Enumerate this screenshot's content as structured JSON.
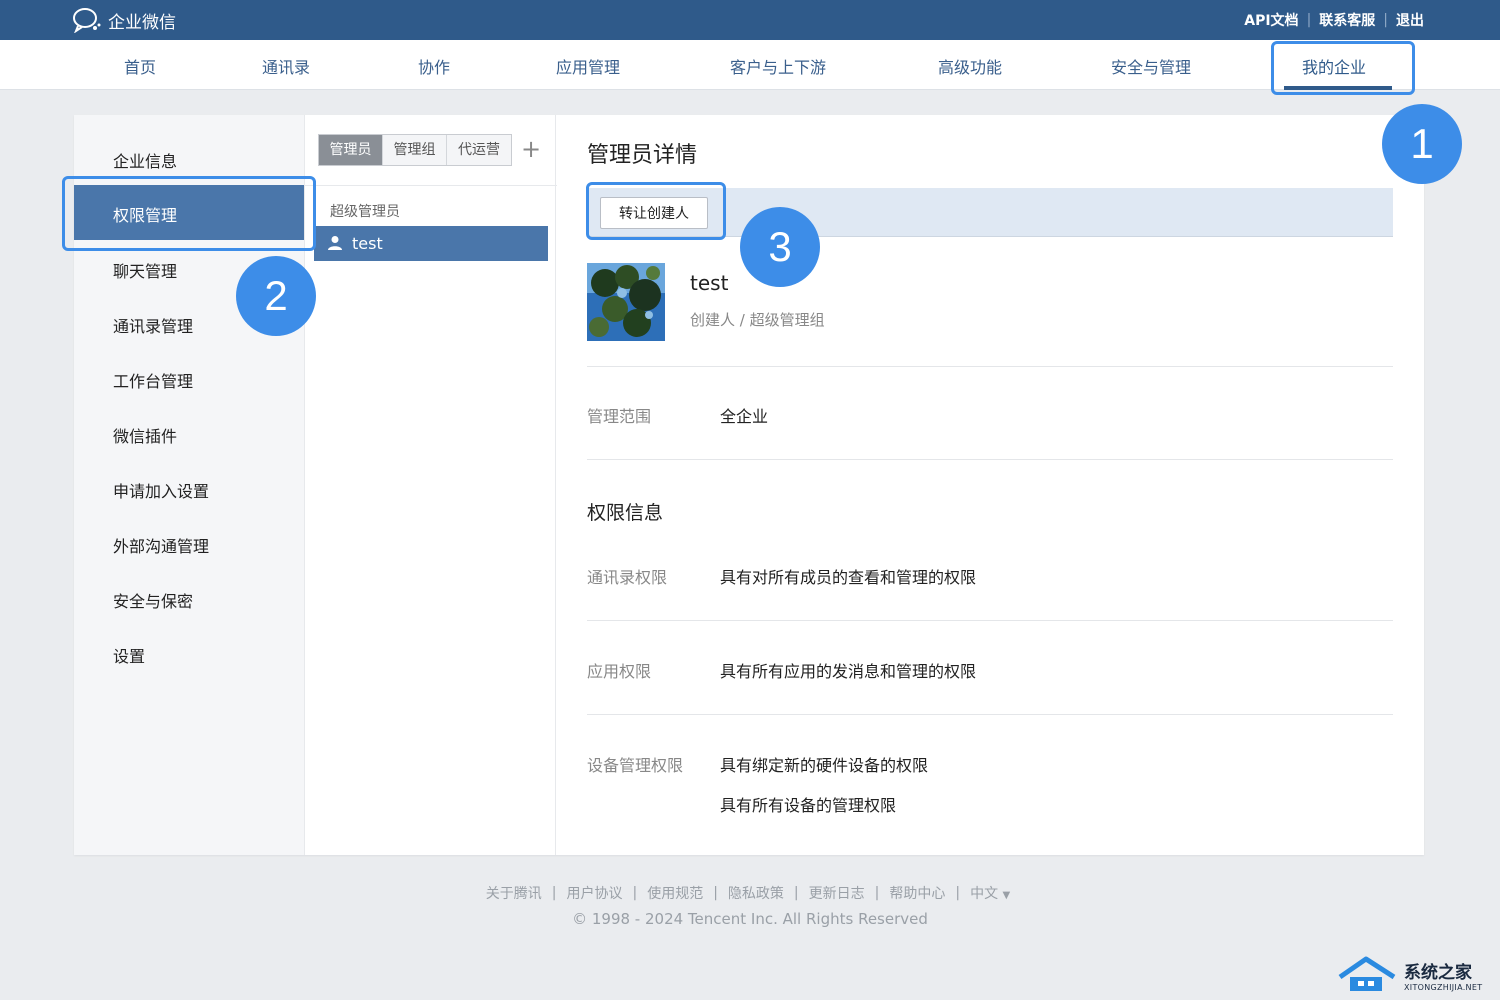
{
  "brand": {
    "name": "企业微信"
  },
  "top_links": {
    "api": "API文档",
    "support": "联系客服",
    "logout": "退出",
    "sep": "|"
  },
  "nav": [
    "首页",
    "通讯录",
    "协作",
    "应用管理",
    "客户与上下游",
    "高级功能",
    "安全与管理",
    "我的企业"
  ],
  "sidebar": [
    "企业信息",
    "权限管理",
    "聊天管理",
    "通讯录管理",
    "工作台管理",
    "微信插件",
    "申请加入设置",
    "外部沟通管理",
    "安全与保密",
    "设置"
  ],
  "tabs": [
    "管理员",
    "管理组",
    "代运营"
  ],
  "add_symbol": "+",
  "admin_group": "超级管理员",
  "admin_user": "test",
  "detail": {
    "title": "管理员详情",
    "transfer_button": "转让创建人",
    "name": "test",
    "role": "创建人 / 超级管理组",
    "scope_label": "管理范围",
    "scope_value": "全企业",
    "perm_title": "权限信息",
    "contacts_label": "通讯录权限",
    "contacts_value": "具有对所有成员的查看和管理的权限",
    "apps_label": "应用权限",
    "apps_value": "具有所有应用的发消息和管理的权限",
    "device_label": "设备管理权限",
    "device_value_1": "具有绑定新的硬件设备的权限",
    "device_value_2": "具有所有设备的管理权限"
  },
  "footer": {
    "links": [
      "关于腾讯",
      "用户协议",
      "使用规范",
      "隐私政策",
      "更新日志",
      "帮助中心",
      "中文"
    ],
    "lang_caret": "▼",
    "copyright": "© 1998 - 2024 Tencent Inc. All Rights Reserved"
  },
  "badges": [
    "1",
    "2",
    "3"
  ],
  "watermark": {
    "title": "系统之家",
    "sub": "XITONGZHIJIA.NET"
  },
  "colors": {
    "topbar": "#2f5a8a",
    "accent": "#4a76aa",
    "highlight": "#3d8de8"
  }
}
